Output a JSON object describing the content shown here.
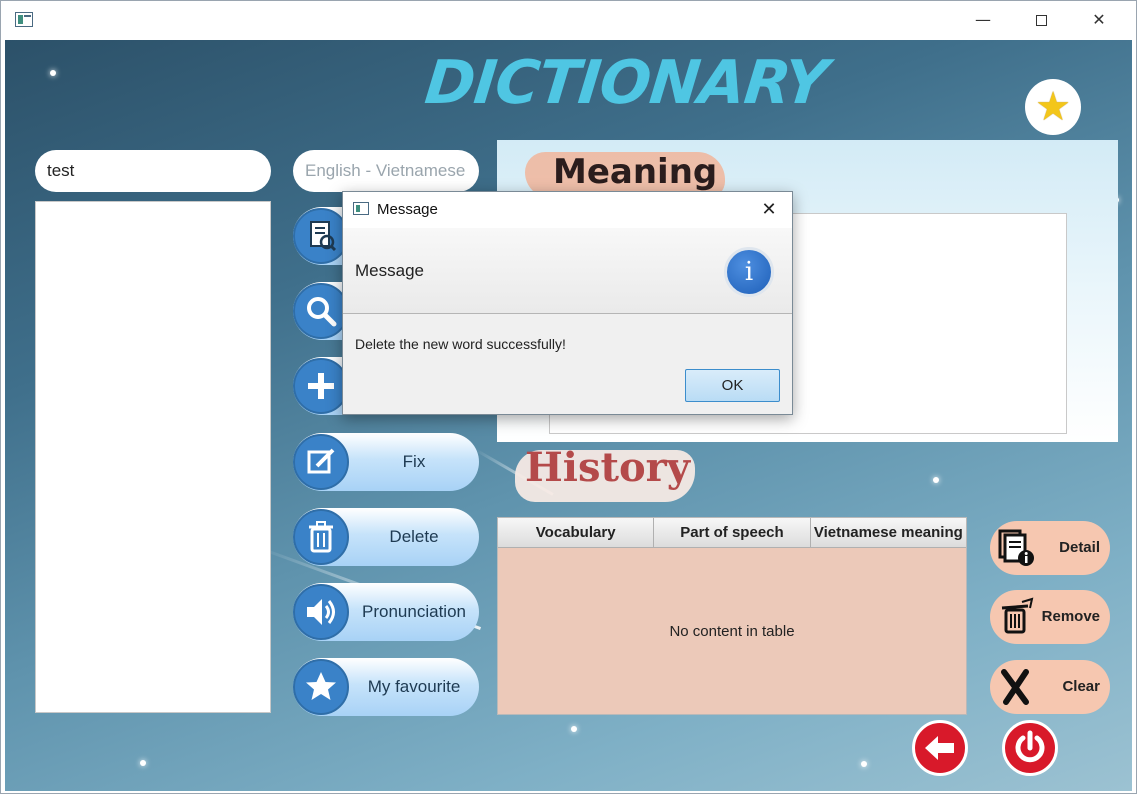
{
  "window": {
    "controls": {
      "minimize": "—",
      "maximize": "",
      "close": "✕"
    }
  },
  "app": {
    "title": "DICTIONARY",
    "favorite_icon": "★"
  },
  "search": {
    "value": "test"
  },
  "language": {
    "selected": "English - Vietnamese"
  },
  "actions": [
    {
      "name": "details",
      "label": ""
    },
    {
      "name": "search",
      "label": ""
    },
    {
      "name": "add",
      "label": ""
    },
    {
      "name": "fix",
      "label": "Fix"
    },
    {
      "name": "delete",
      "label": "Delete"
    },
    {
      "name": "pronunciation",
      "label": "Pronunciation"
    },
    {
      "name": "my-favourite",
      "label": "My favourite"
    }
  ],
  "meaning": {
    "title": "Meaning"
  },
  "history": {
    "title": "History",
    "columns": [
      "Vocabulary",
      "Part of speech",
      "Vietnamese meaning"
    ],
    "placeholder": "No content in table"
  },
  "history_buttons": {
    "detail": "Detail",
    "remove": "Remove",
    "clear": "Clear"
  },
  "dialog": {
    "title": "Message",
    "close": "✕",
    "header": "Message",
    "info_glyph": "i",
    "message": "Delete the new word successfully!",
    "ok": "OK"
  },
  "colors": {
    "title": "#4fc6e3",
    "pill_icon": "#3a82c8",
    "history_title": "#b44a4a",
    "side_button": "#f6c7b0",
    "table_body": "#ecc9b9",
    "round_button": "#d8192a"
  }
}
